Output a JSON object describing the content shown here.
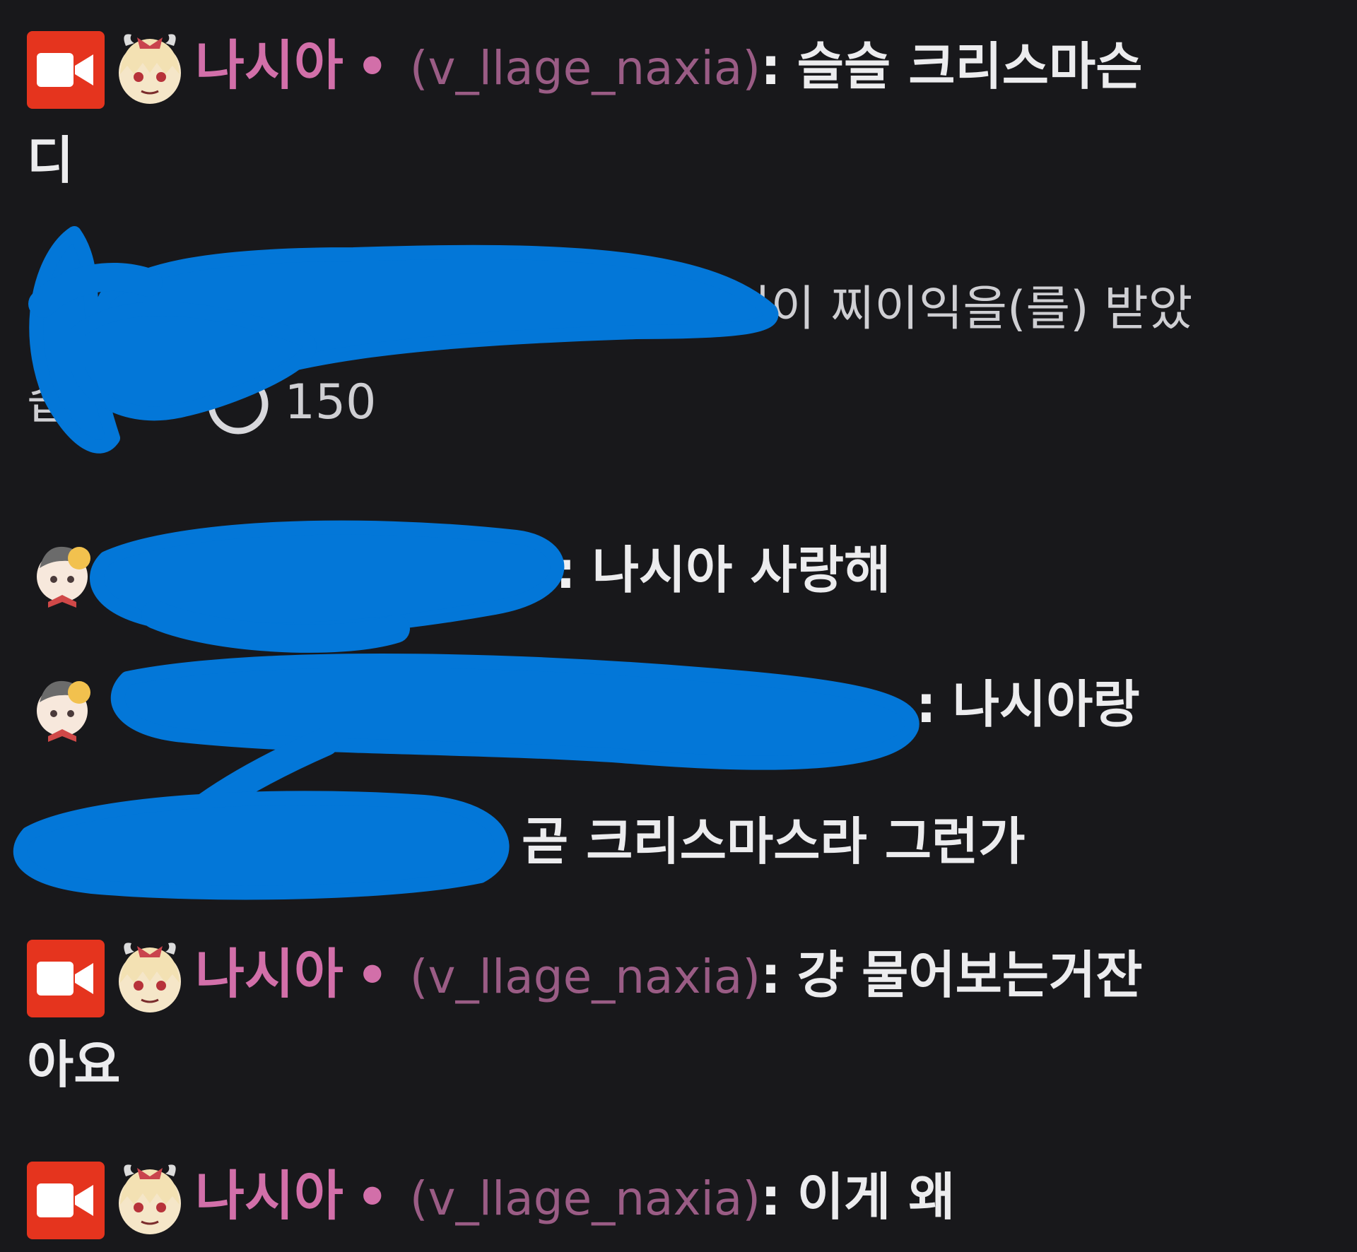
{
  "chat": {
    "messages": [
      {
        "display_name": "나시아",
        "separator": "•",
        "login": "(v_llage_naxia)",
        "colon": ":",
        "text_line1": "슬슬 크리스마슨",
        "text_line2": "디"
      },
      {
        "redeem_text": "님이 찌이익을(를) 받았",
        "redeem_text_line2": "습",
        "points": "150"
      },
      {
        "colon": ":",
        "text": "나시아 사랑해"
      },
      {
        "colon": ":",
        "text_line1": "나시아랑",
        "text_line2": "곧 크리스마스라 그런가"
      },
      {
        "display_name": "나시아",
        "separator": "•",
        "login": "(v_llage_naxia)",
        "colon": ":",
        "text_line1": "걍 물어보는거잔",
        "text_line2": "아요"
      },
      {
        "display_name": "나시아",
        "separator": "•",
        "login": "(v_llage_naxia)",
        "colon": ":",
        "text_line1": "이게 왜"
      }
    ]
  },
  "colors": {
    "background": "#18181b",
    "streamer_name": "#d26fa9",
    "login": "#9a5c85",
    "message_text": "#ececee",
    "redaction_scribble": "#0377d8",
    "broadcaster_badge": "#e5341e"
  },
  "icons": {
    "broadcaster_badge": "video-camera-icon",
    "streamer_avatar": "anime-girl-emote-icon",
    "viewer_avatar": "chibi-emote-icon",
    "channel_points": "channel-points-icon"
  }
}
